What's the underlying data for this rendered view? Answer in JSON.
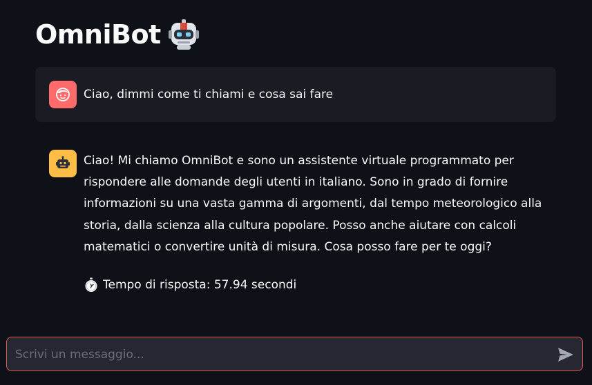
{
  "app": {
    "title": "OmniBot",
    "title_icon": "robot-emoji-icon"
  },
  "messages": [
    {
      "role": "user",
      "avatar_icon": "user-face-icon",
      "avatar_color": "#ff6b6b",
      "text": "Ciao, dimmi come ti chiami e cosa sai fare"
    },
    {
      "role": "assistant",
      "avatar_icon": "bot-icon",
      "avatar_color": "#ffbd45",
      "lines": [
        "Ciao! Mi chiamo OmniBot e sono un assistente virtuale programmato per",
        "rispondere alle domande degli utenti in italiano. Sono in grado di fornire",
        "informazioni su una vasta gamma di argomenti, dal tempo meteorologico alla",
        "storia, dalla scienza alla cultura popolare. Posso anche aiutare con calcoli",
        "matematici o convertire unità di misura. Cosa posso fare per te oggi?"
      ],
      "timer_icon": "stopwatch-icon",
      "response_time": "Tempo di risposta: 57.94 secondi"
    }
  ],
  "chat_input": {
    "placeholder": "Scrivi un messaggio...",
    "value": "",
    "send_icon": "send-icon",
    "border_color": "#e8574f"
  }
}
